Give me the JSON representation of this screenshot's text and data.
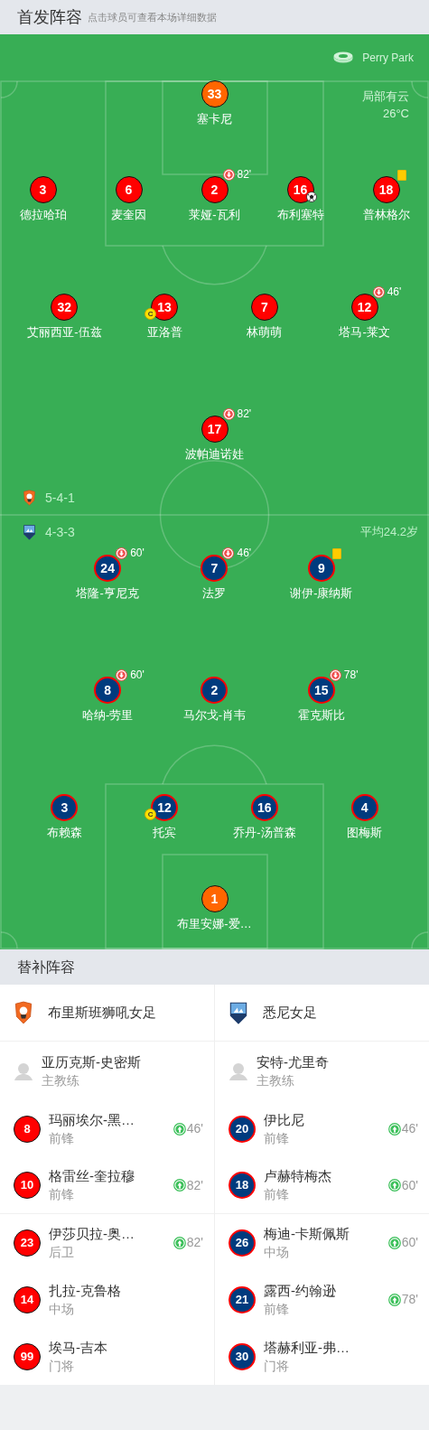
{
  "header": {
    "title": "首发阵容",
    "hint": "点击球员可查看本场详细数据"
  },
  "pitch": {
    "venue": "Perry Park",
    "weather": "局部有云",
    "temperature": "26°C",
    "home": {
      "kind": "home",
      "formation": "5-4-1",
      "lines": [
        {
          "players": [
            {
              "number": "33",
              "name": "塞卡尼",
              "kind": "goalkeeper"
            }
          ]
        },
        {
          "players": [
            {
              "number": "3",
              "name": "德拉哈珀",
              "kind": "outfield"
            },
            {
              "number": "6",
              "name": "麦奎因",
              "kind": "outfield"
            },
            {
              "number": "2",
              "name": "莱娅-瓦利",
              "kind": "outfield",
              "sub_off": "82'"
            },
            {
              "number": "16",
              "name": "布利塞特",
              "kind": "outfield",
              "goal": true
            },
            {
              "number": "18",
              "name": "普林格尔",
              "kind": "outfield",
              "yellow_card": true
            }
          ]
        },
        {
          "players": [
            {
              "number": "32",
              "name": "艾丽西亚-伍兹",
              "kind": "outfield"
            },
            {
              "number": "13",
              "name": "亚洛普",
              "kind": "outfield",
              "captain": "C"
            },
            {
              "number": "7",
              "name": "林萌萌",
              "kind": "outfield"
            },
            {
              "number": "12",
              "name": "塔马-莱文",
              "kind": "outfield",
              "sub_off": "46'"
            }
          ]
        },
        {
          "players": [
            {
              "number": "17",
              "name": "波帕迪诺娃",
              "kind": "outfield",
              "sub_off": "82'"
            }
          ]
        }
      ]
    },
    "away": {
      "kind": "away",
      "formation": "4-3-3",
      "average_age": "平均24.2岁",
      "lines": [
        {
          "players": [
            {
              "number": "24",
              "name": "塔隆-亨尼克",
              "kind": "outfield",
              "sub_off": "60'"
            },
            {
              "number": "7",
              "name": "法罗",
              "kind": "outfield",
              "sub_off": "46'"
            },
            {
              "number": "9",
              "name": "谢伊-康纳斯",
              "kind": "outfield",
              "yellow_card": true
            }
          ]
        },
        {
          "players": [
            {
              "number": "8",
              "name": "哈纳-劳里",
              "kind": "outfield",
              "sub_off": "60'"
            },
            {
              "number": "2",
              "name": "马尔戈-肖韦",
              "kind": "outfield"
            },
            {
              "number": "15",
              "name": "霍克斯比",
              "kind": "outfield",
              "sub_off": "78'"
            }
          ]
        },
        {
          "players": [
            {
              "number": "3",
              "name": "布赖森",
              "kind": "outfield"
            },
            {
              "number": "12",
              "name": "托宾",
              "kind": "outfield",
              "captain": "C"
            },
            {
              "number": "16",
              "name": "乔丹-汤普森",
              "kind": "outfield"
            },
            {
              "number": "4",
              "name": "图梅斯",
              "kind": "outfield"
            }
          ]
        },
        {
          "players": [
            {
              "number": "1",
              "name": "布里安娜-爱…",
              "kind": "goalkeeper"
            }
          ]
        }
      ]
    }
  },
  "bench": {
    "title": "替补阵容",
    "teams": [
      {
        "kind": "home",
        "name": "布里斯班狮吼女足",
        "coach": {
          "name": "亚历克斯-史密斯",
          "role": "主教练"
        },
        "subs": [
          {
            "number": "8",
            "name": "玛丽埃尔-黑…",
            "position": "前锋",
            "sub_on": "46'"
          },
          {
            "number": "10",
            "name": "格雷丝-奎拉穆",
            "position": "前锋",
            "sub_on": "82'"
          },
          {
            "number": "23",
            "name": "伊莎贝拉-奥…",
            "position": "后卫",
            "sub_on": "82'"
          },
          {
            "number": "14",
            "name": "扎拉-克鲁格",
            "position": "中场"
          },
          {
            "number": "99",
            "name": "埃马-吉本",
            "position": "门将"
          }
        ]
      },
      {
        "kind": "away",
        "name": "悉尼女足",
        "coach": {
          "name": "安特-尤里奇",
          "role": "主教练"
        },
        "subs": [
          {
            "number": "20",
            "name": "伊比尼",
            "position": "前锋",
            "sub_on": "46'"
          },
          {
            "number": "18",
            "name": "卢赫特梅杰",
            "position": "前锋",
            "sub_on": "60'"
          },
          {
            "number": "26",
            "name": "梅迪-卡斯佩斯",
            "position": "中场",
            "sub_on": "60'"
          },
          {
            "number": "21",
            "name": "露西-约翰逊",
            "position": "前锋",
            "sub_on": "78'"
          },
          {
            "number": "30",
            "name": "塔赫利亚-弗…",
            "position": "门将"
          }
        ]
      }
    ]
  }
}
